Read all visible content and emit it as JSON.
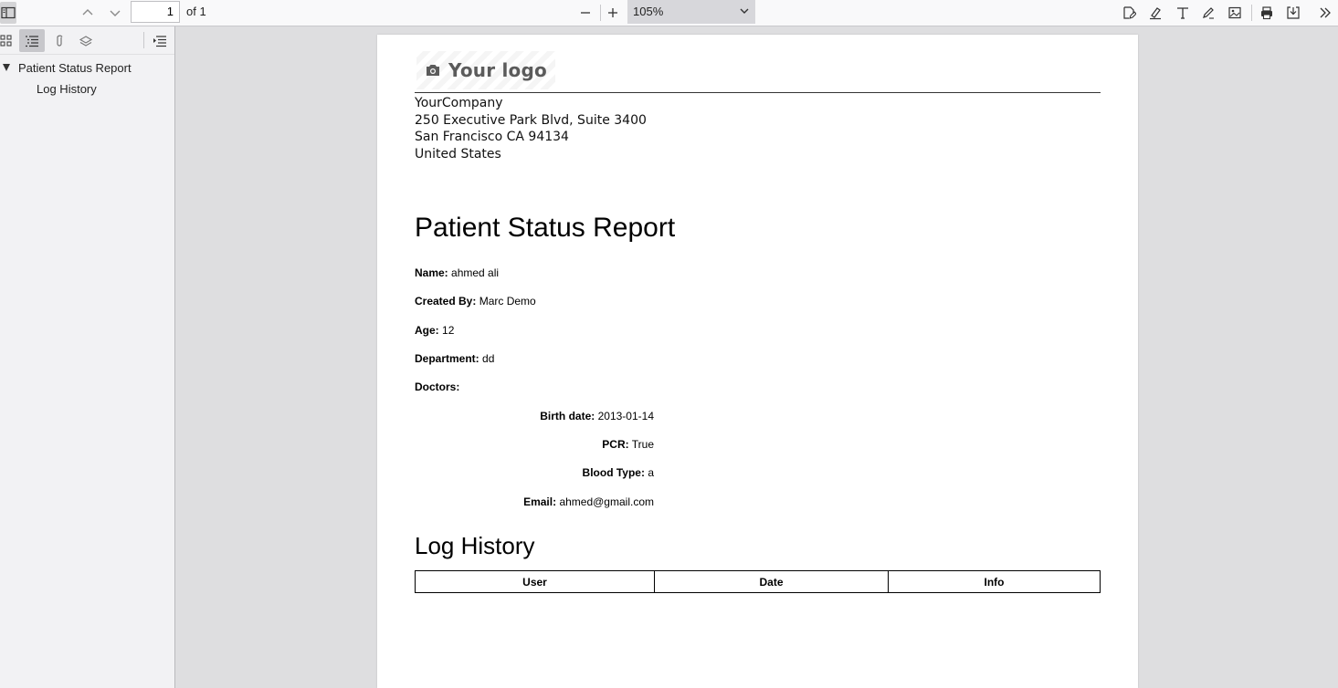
{
  "toolbar": {
    "page_number": "1",
    "page_count_label": "of 1",
    "zoom_value": "105%"
  },
  "sidebar": {
    "outline": [
      {
        "label": "Patient Status Report"
      },
      {
        "label": "Log History"
      }
    ]
  },
  "document": {
    "logo_text": "Your logo",
    "company": {
      "name": "YourCompany",
      "street": "250 Executive Park Blvd, Suite 3400",
      "city": "San Francisco CA 94134",
      "country": "United States"
    },
    "title": "Patient Status Report",
    "fields": {
      "name": {
        "label": "Name:",
        "value": "ahmed ali"
      },
      "created_by": {
        "label": "Created By:",
        "value": "Marc Demo"
      },
      "age": {
        "label": "Age:",
        "value": "12"
      },
      "department": {
        "label": "Department:",
        "value": "dd"
      },
      "doctors": {
        "label": "Doctors:",
        "value": ""
      },
      "birth_date": {
        "label": "Birth date:",
        "value": "2013-01-14"
      },
      "pcr": {
        "label": "PCR:",
        "value": "True"
      },
      "blood_type": {
        "label": "Blood Type:",
        "value": "a"
      },
      "email": {
        "label": "Email:",
        "value": "ahmed@gmail.com"
      }
    },
    "log_history": {
      "title": "Log History",
      "columns": [
        "User",
        "Date",
        "Info"
      ]
    }
  }
}
